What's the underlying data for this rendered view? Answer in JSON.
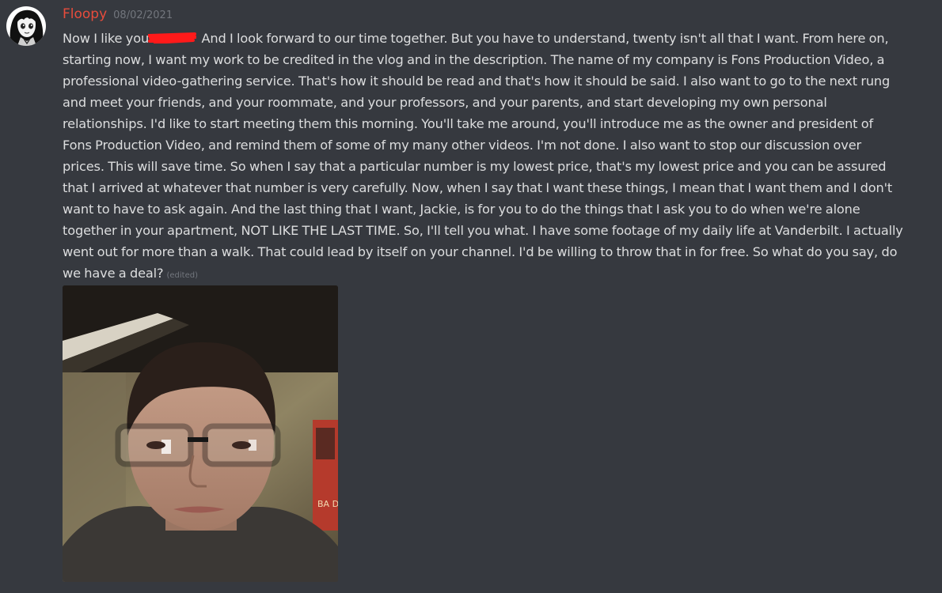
{
  "message": {
    "author": "Floopy",
    "timestamp": "08/02/2021",
    "text_before_redaction": "Now I like you",
    "text_after_redaction": " And I look forward to our time together. But you have to understand, twenty isn't all that I want. From here on, starting now, I want my work to be credited in the vlog and in the description. The name of my company is Fons Production Video, a professional video-gathering service. That's how it should be read and that's how it should be said. I also want to go to the next rung and meet your friends, and your roommate, and your professors, and your parents, and start developing my own personal relationships. I'd like to start meeting them this morning. You'll take me around, you'll introduce me as the owner and president of Fons Production Video, and remind them of some of my many other videos. I'm not done. I also want to stop our discussion over prices. This will save time. So when I say that a particular number is my lowest price, that's my lowest price and you can be assured that I arrived at whatever that number is very carefully. Now, when I say that I want these things, I mean that I want them and I don't want to have to ask again. And the last thing that I want, Jackie, is for you to do the things that I ask you to do when we're alone together in your apartment, NOT LIKE THE LAST TIME. So, I'll tell you what. I have some footage of my daily life at Vanderbilt. I actually went out for more than a walk. That could lead by itself on your channel. I'd be willing to throw that in for free. So what do you say, do we have a deal?",
    "edited_label": "(edited)",
    "poster_text": "BA DR"
  },
  "colors": {
    "background": "#36393f",
    "username": "#e74c3c",
    "message_text": "#dcddde",
    "muted": "#72767d",
    "redaction": "#ff1a1a"
  },
  "icons": {
    "avatar": "anime-girl-avatar",
    "attachment": "selfie-photo"
  }
}
